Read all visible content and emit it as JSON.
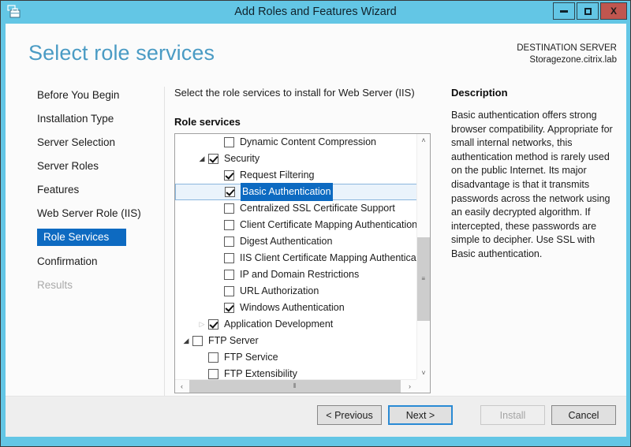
{
  "window": {
    "title": "Add Roles and Features Wizard",
    "icon": "server-toolbox-icon",
    "controls": {
      "minimize": "minimize-icon",
      "maximize": "maximize-icon",
      "close": "X"
    },
    "frame_color": "#63c6e5"
  },
  "header": {
    "page_title": "Select role services",
    "destination_label": "DESTINATION SERVER",
    "destination_server": "Storagezone.citrix.lab",
    "title_color": "#4a9bc4"
  },
  "sidebar": {
    "items": [
      {
        "label": "Before You Begin",
        "state": "normal"
      },
      {
        "label": "Installation Type",
        "state": "normal"
      },
      {
        "label": "Server Selection",
        "state": "normal"
      },
      {
        "label": "Server Roles",
        "state": "normal"
      },
      {
        "label": "Features",
        "state": "normal"
      },
      {
        "label": "Web Server Role (IIS)",
        "state": "normal"
      },
      {
        "label": "Role Services",
        "state": "active"
      },
      {
        "label": "Confirmation",
        "state": "normal"
      },
      {
        "label": "Results",
        "state": "disabled"
      }
    ],
    "active_color": "#0d6ac1"
  },
  "main": {
    "instruction": "Select the role services to install for Web Server (IIS)",
    "section_label": "Role services",
    "rows": [
      {
        "label": "Dynamic Content Compression",
        "indent": 2,
        "checked": false,
        "triangle": "none"
      },
      {
        "label": "Security",
        "indent": 1,
        "checked": true,
        "triangle": "expanded"
      },
      {
        "label": "Request Filtering",
        "indent": 2,
        "checked": true,
        "triangle": "none"
      },
      {
        "label": "Basic Authentication",
        "indent": 2,
        "checked": true,
        "triangle": "none",
        "selected": true
      },
      {
        "label": "Centralized SSL Certificate Support",
        "indent": 2,
        "checked": false,
        "triangle": "none"
      },
      {
        "label": "Client Certificate Mapping Authentication",
        "indent": 2,
        "checked": false,
        "triangle": "none"
      },
      {
        "label": "Digest Authentication",
        "indent": 2,
        "checked": false,
        "triangle": "none"
      },
      {
        "label": "IIS Client Certificate Mapping Authentication",
        "indent": 2,
        "checked": false,
        "triangle": "none"
      },
      {
        "label": "IP and Domain Restrictions",
        "indent": 2,
        "checked": false,
        "triangle": "none"
      },
      {
        "label": "URL Authorization",
        "indent": 2,
        "checked": false,
        "triangle": "none"
      },
      {
        "label": "Windows Authentication",
        "indent": 2,
        "checked": true,
        "triangle": "none"
      },
      {
        "label": "Application Development",
        "indent": 1,
        "checked": true,
        "triangle": "collapsed"
      },
      {
        "label": "FTP Server",
        "indent": 0,
        "checked": false,
        "triangle": "expanded"
      },
      {
        "label": "FTP Service",
        "indent": 1,
        "checked": false,
        "triangle": "none"
      },
      {
        "label": "FTP Extensibility",
        "indent": 1,
        "checked": false,
        "triangle": "none"
      }
    ],
    "scroll": {
      "up_arrow": "˄",
      "down_arrow": "˅",
      "left_arrow": "‹",
      "right_arrow": "›",
      "thumb_grip": "≡",
      "hthumb_grip": "⦀"
    }
  },
  "description": {
    "title": "Description",
    "body": "Basic authentication offers strong browser compatibility. Appropriate for small internal networks, this authentication method is rarely used on the public Internet. Its major disadvantage is that it transmits passwords across the network using an easily decrypted algorithm. If intercepted, these passwords are simple to decipher. Use SSL with Basic authentication."
  },
  "footer": {
    "previous": "< Previous",
    "next": "Next >",
    "install": "Install",
    "cancel": "Cancel"
  }
}
